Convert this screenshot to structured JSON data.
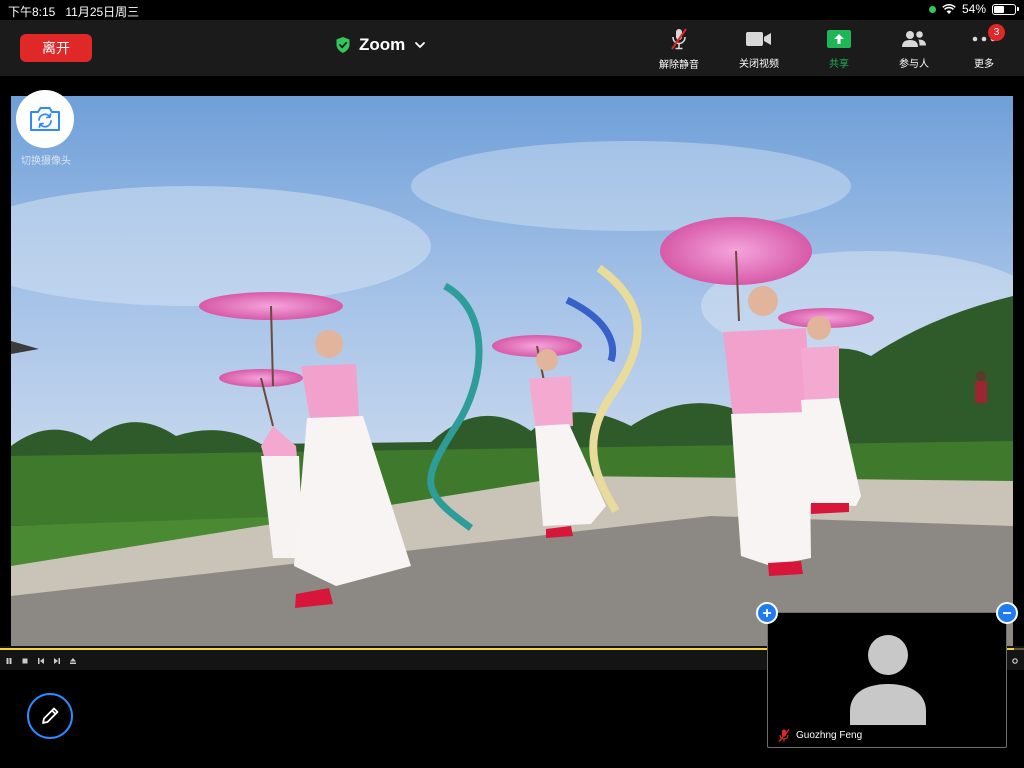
{
  "status_bar": {
    "time": "下午8:15",
    "date": "11月25日周三",
    "battery_text": "54%",
    "battery_level": 0.54
  },
  "toolbar": {
    "leave_label": "离开",
    "meeting_title": "Zoom",
    "buttons": [
      {
        "label": "解除静音",
        "icon": "mic-muted-icon"
      },
      {
        "label": "关闭视频",
        "icon": "video-camera-icon"
      },
      {
        "label": "共享",
        "icon": "share-screen-icon"
      },
      {
        "label": "参与人",
        "icon": "participants-icon"
      },
      {
        "label": "更多",
        "icon": "more-icon",
        "badge": "3"
      }
    ]
  },
  "video": {
    "switch_camera_label": "切换摄像头",
    "player": {
      "progress": 0.99
    }
  },
  "self_view": {
    "name": "Guozhng Feng"
  },
  "colors": {
    "leave": "#e02828",
    "share": "#1eb657",
    "accent": "#1f7bf2",
    "shield": "#33c759"
  }
}
